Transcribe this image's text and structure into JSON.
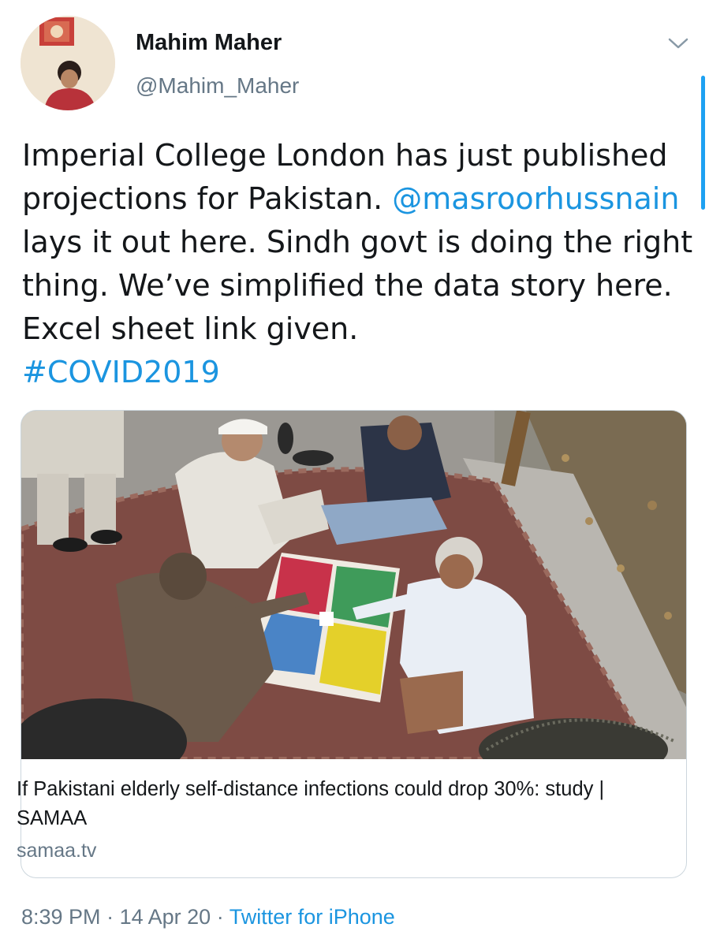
{
  "author": {
    "display_name": "Mahim Maher",
    "handle": "@Mahim_Maher"
  },
  "tweet": {
    "lines": [
      "Imperial College London has just published",
      "projections for Pakistan.",
      "lays it out here. Sindh govt is doing the right",
      "thing. We’ve simplified the data story here.",
      "Excel sheet link given."
    ],
    "mention": "@masroorhussnain",
    "hashtag": "#COVID2019"
  },
  "card": {
    "title": "If Pakistani elderly self-distance infections could drop 30%: study | SAMAA",
    "domain": "samaa.tv"
  },
  "meta": {
    "time": "8:39 PM",
    "separator": "·",
    "date": "14 Apr 20",
    "source": "Twitter for iPhone"
  },
  "icons": {
    "caret": "chevron-down-icon"
  },
  "colors": {
    "link": "#1b95e0",
    "secondary_text": "#657786",
    "border": "#ccd6dd",
    "scroll_indicator": "#1da1f2"
  }
}
